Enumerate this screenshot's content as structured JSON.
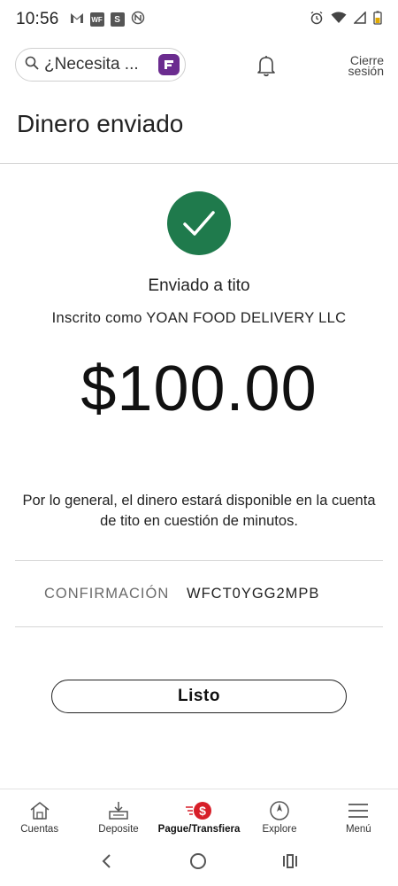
{
  "status_bar": {
    "time": "10:56",
    "left_icons": [
      "gmail-icon",
      "wf-icon",
      "s-icon",
      "nfc-icon"
    ],
    "right_icons": [
      "alarm-icon",
      "wifi-icon",
      "signal-icon",
      "battery-icon"
    ]
  },
  "header": {
    "search_placeholder": "¿Necesita ...",
    "signout_line1": "Cierre",
    "signout_line2": "sesión"
  },
  "page": {
    "title": "Dinero enviado",
    "sent_to": "Enviado a tito",
    "enrolled_as": "Inscrito como YOAN FOOD DELIVERY LLC",
    "amount": "$100.00",
    "note": "Por lo general, el dinero estará disponible en la cuenta de tito en cuestión de minutos.",
    "confirmation_label": "CONFIRMACIÓN",
    "confirmation_value": "WFCT0YGG2MPB",
    "done_label": "Listo"
  },
  "bottom_nav": {
    "items": [
      {
        "label": "Cuentas",
        "icon": "home-icon",
        "active": false
      },
      {
        "label": "Deposite",
        "icon": "deposit-icon",
        "active": false
      },
      {
        "label": "Pague/Transfiera",
        "icon": "pay-transfer-icon",
        "active": true
      },
      {
        "label": "Explore",
        "icon": "compass-icon",
        "active": false
      },
      {
        "label": "Menú",
        "icon": "menu-icon",
        "active": false
      }
    ]
  },
  "colors": {
    "success_green": "#1f7a4c",
    "brand_red": "#d71e28",
    "fargo_purple": "#6b2c8f"
  }
}
